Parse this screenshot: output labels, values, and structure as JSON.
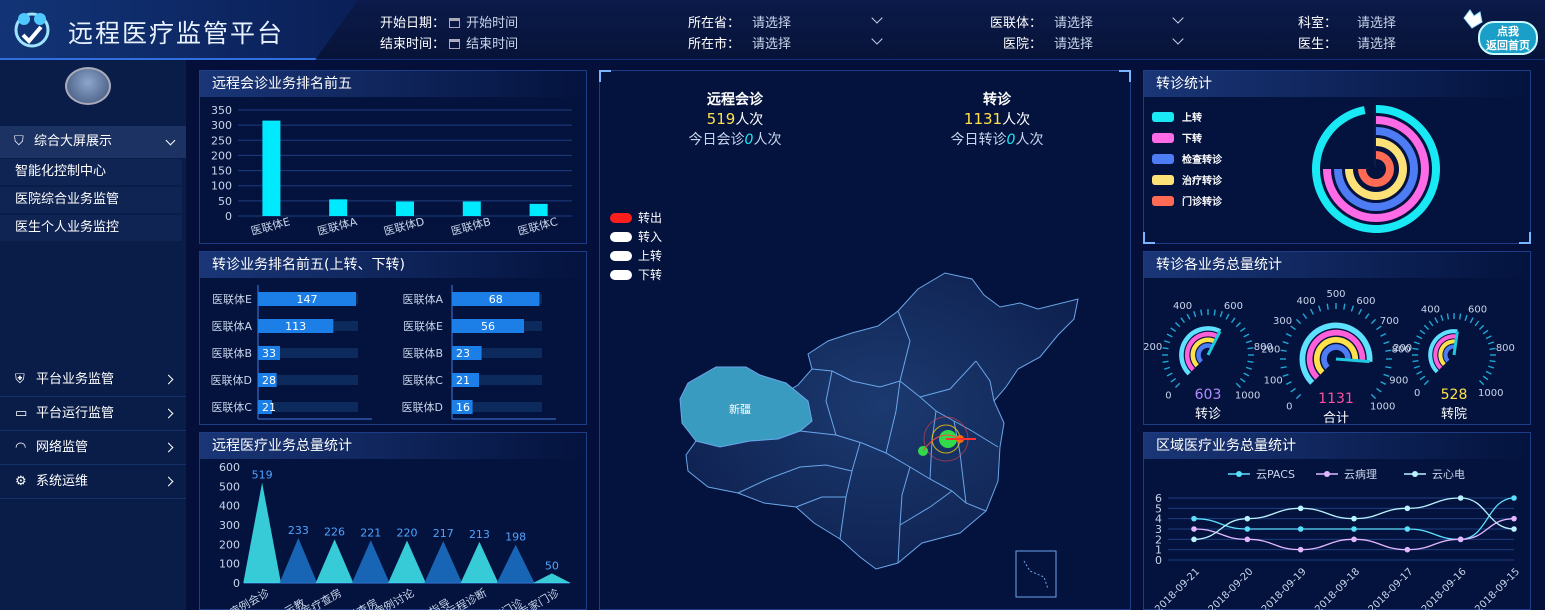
{
  "header": {
    "title": "远程医疗监管平台",
    "home_button": "返回首页",
    "filters": {
      "start_date_label": "开始日期：",
      "start_date_placeholder": "开始时间",
      "end_date_label": "结束时间：",
      "end_date_placeholder": "结束时间",
      "province_label": "所在省：",
      "province_value": "请选择",
      "city_label": "所在市：",
      "city_value": "请选择",
      "alliance_label": "医联体：",
      "alliance_value": "请选择",
      "hospital_label": "医院：",
      "hospital_value": "请选择",
      "dept_label": "科室：",
      "dept_value": "请选择",
      "doctor_label": "医生：",
      "doctor_value": "请选择"
    }
  },
  "sidebar": {
    "top_item": "综合大屏展示",
    "sub_items": [
      "智能化控制中心",
      "医院综合业务监管",
      "医生个人业务监控"
    ],
    "groups": [
      "平台业务监管",
      "平台运行监管",
      "网络监管",
      "系统运维"
    ]
  },
  "panels": {
    "consult_top5": {
      "title": "远程会诊业务排名前五",
      "chart_data": {
        "type": "bar",
        "categories": [
          "医联体E",
          "医联体A",
          "医联体D",
          "医联体B",
          "医联体C"
        ],
        "values": [
          315,
          55,
          48,
          48,
          40
        ],
        "ylim": [
          0,
          350
        ],
        "yticks": [
          0,
          50,
          100,
          150,
          200,
          250,
          300,
          350
        ],
        "color": "#00eaff"
      }
    },
    "referral_top5": {
      "title": "转诊业务排名前五(上转、下转)",
      "chart_data": [
        {
          "type": "bar",
          "orientation": "horizontal",
          "categories": [
            "医联体E",
            "医联体A",
            "医联体B",
            "医联体D",
            "医联体C"
          ],
          "values": [
            147,
            113,
            33,
            28,
            21
          ],
          "max": 150
        },
        {
          "type": "bar",
          "orientation": "horizontal",
          "categories": [
            "医联体A",
            "医联体E",
            "医联体B",
            "医联体C",
            "医联体D"
          ],
          "values": [
            68,
            56,
            23,
            21,
            16
          ],
          "max": 70
        }
      ]
    },
    "telemed_total": {
      "title": "远程医疗业务总量统计",
      "chart_data": {
        "type": "bar",
        "categories": [
          "病例会诊",
          "手术示教",
          "医疗查房",
          "教学查房",
          "疑难病例讨论",
          "手术指导",
          "远程诊断",
          "专家门诊",
          "远程专家门诊"
        ],
        "values": [
          519,
          233,
          226,
          221,
          220,
          217,
          213,
          198,
          50
        ],
        "ylim": [
          0,
          600
        ],
        "yticks": [
          0,
          100,
          200,
          300,
          400,
          500,
          600
        ]
      }
    },
    "map": {
      "consult_title": "远程会诊",
      "consult_count": "519",
      "consult_unit": "人次",
      "consult_today": "今日会诊",
      "consult_today_n": "0",
      "consult_today_unit": "人次",
      "referral_title": "转诊",
      "referral_count": "1131",
      "referral_unit": "人次",
      "referral_today": "今日转诊",
      "referral_today_n": "0",
      "referral_today_unit": "人次",
      "legend": [
        {
          "label": "转出",
          "color": "#ff1e1e"
        },
        {
          "label": "转入",
          "color": "#ffffff"
        },
        {
          "label": "上转",
          "color": "#ffffff"
        },
        {
          "label": "下转",
          "color": "#ffffff"
        }
      ],
      "region_label": "新疆"
    },
    "referral_stats": {
      "title": "转诊统计",
      "chart_data": {
        "type": "pie",
        "series": [
          {
            "name": "上转",
            "color": "#19e8f5",
            "fraction": 0.97
          },
          {
            "name": "下转",
            "color": "#ff6ae6",
            "fraction": 0.75
          },
          {
            "name": "检查转诊",
            "color": "#4d7cf5",
            "fraction": 0.75
          },
          {
            "name": "治疗转诊",
            "color": "#ffe277",
            "fraction": 0.75
          },
          {
            "name": "门诊转诊",
            "color": "#ff6a55",
            "fraction": 0.75
          }
        ]
      }
    },
    "gauges": {
      "title": "转诊各业务总量统计",
      "items": [
        {
          "value": "603",
          "label": "转诊",
          "color": "#b48cff",
          "ticks": [
            "0",
            "200",
            "400",
            "600",
            "800",
            "1000"
          ],
          "fraction": 0.6
        },
        {
          "value": "1131",
          "label": "合计",
          "color": "#ff4fa0",
          "ticks": [
            "0",
            "100",
            "200",
            "300",
            "400",
            "500",
            "600",
            "700",
            "800",
            "900",
            "1000"
          ],
          "fraction": 0.85
        },
        {
          "value": "528",
          "label": "转院",
          "color": "#ffe24a",
          "ticks": [
            "0",
            "200",
            "400",
            "600",
            "800",
            "1000"
          ],
          "fraction": 0.53
        }
      ]
    },
    "regional": {
      "title": "区域医疗业务总量统计",
      "chart_data": {
        "type": "line",
        "categories": [
          "2018-09-21",
          "2018-09-20",
          "2018-09-19",
          "2018-09-18",
          "2018-09-17",
          "2018-09-16",
          "2018-09-15"
        ],
        "ylim": [
          0,
          6
        ],
        "yticks": [
          0,
          1,
          2,
          3,
          4,
          5,
          6
        ],
        "series": [
          {
            "name": "云PACS",
            "color": "#5ae0ff",
            "values": [
              4,
              3,
              3,
              3,
              3,
              2,
              6
            ]
          },
          {
            "name": "云病理",
            "color": "#e2b7ff",
            "values": [
              3,
              2,
              1,
              2,
              1,
              2,
              4
            ]
          },
          {
            "name": "云心电",
            "color": "#b9f3ff",
            "values": [
              2,
              4,
              5,
              4,
              5,
              6,
              3
            ]
          }
        ]
      }
    }
  }
}
